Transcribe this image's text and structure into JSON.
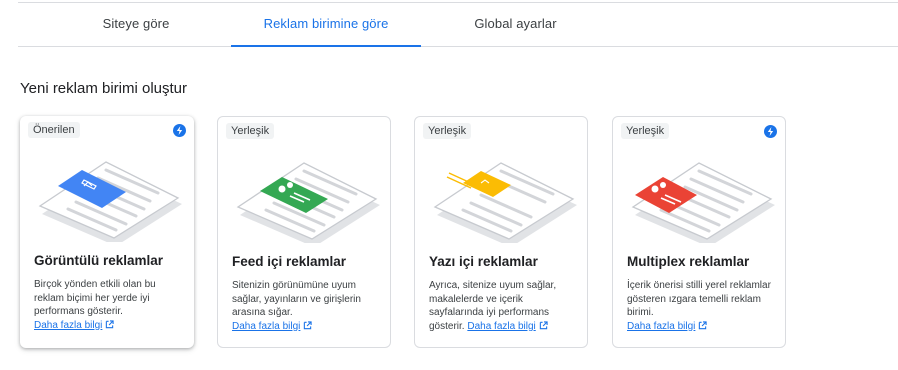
{
  "tabs": [
    {
      "label": "Siteye göre",
      "active": false
    },
    {
      "label": "Reklam birimine göre",
      "active": true
    },
    {
      "label": "Global ayarlar",
      "active": false
    }
  ],
  "section_title": "Yeni reklam birimi oluştur",
  "cards": [
    {
      "badge": "Önerilen",
      "title": "Görüntülü reklamlar",
      "desc": "Birçok yönden etkili olan bu reklam biçimi her yerde iyi performans gösterir.",
      "link": "Daha fazla bilgi",
      "bolt_icon": true,
      "accent": "#4285f4"
    },
    {
      "badge": "Yerleşik",
      "title": "Feed içi reklamlar",
      "desc": "Sitenizin görünümüne uyum sağlar, yayınların ve girişlerin arasına sığar.",
      "link": "Daha fazla bilgi",
      "bolt_icon": false,
      "accent": "#34a853"
    },
    {
      "badge": "Yerleşik",
      "title": "Yazı içi reklamlar",
      "desc": "Ayrıca, sitenize uyum sağlar, makalelerde ve içerik sayfalarında iyi performans gösterir.",
      "link": "Daha fazla bilgi",
      "bolt_icon": false,
      "accent": "#fbbc04"
    },
    {
      "badge": "Yerleşik",
      "title": "Multiplex reklamlar",
      "desc": "İçerik önerisi stilli yerel reklamlar gösteren ızgara temelli reklam birimi.",
      "link": "Daha fazla bilgi",
      "bolt_icon": true,
      "accent": "#ea4335"
    }
  ]
}
